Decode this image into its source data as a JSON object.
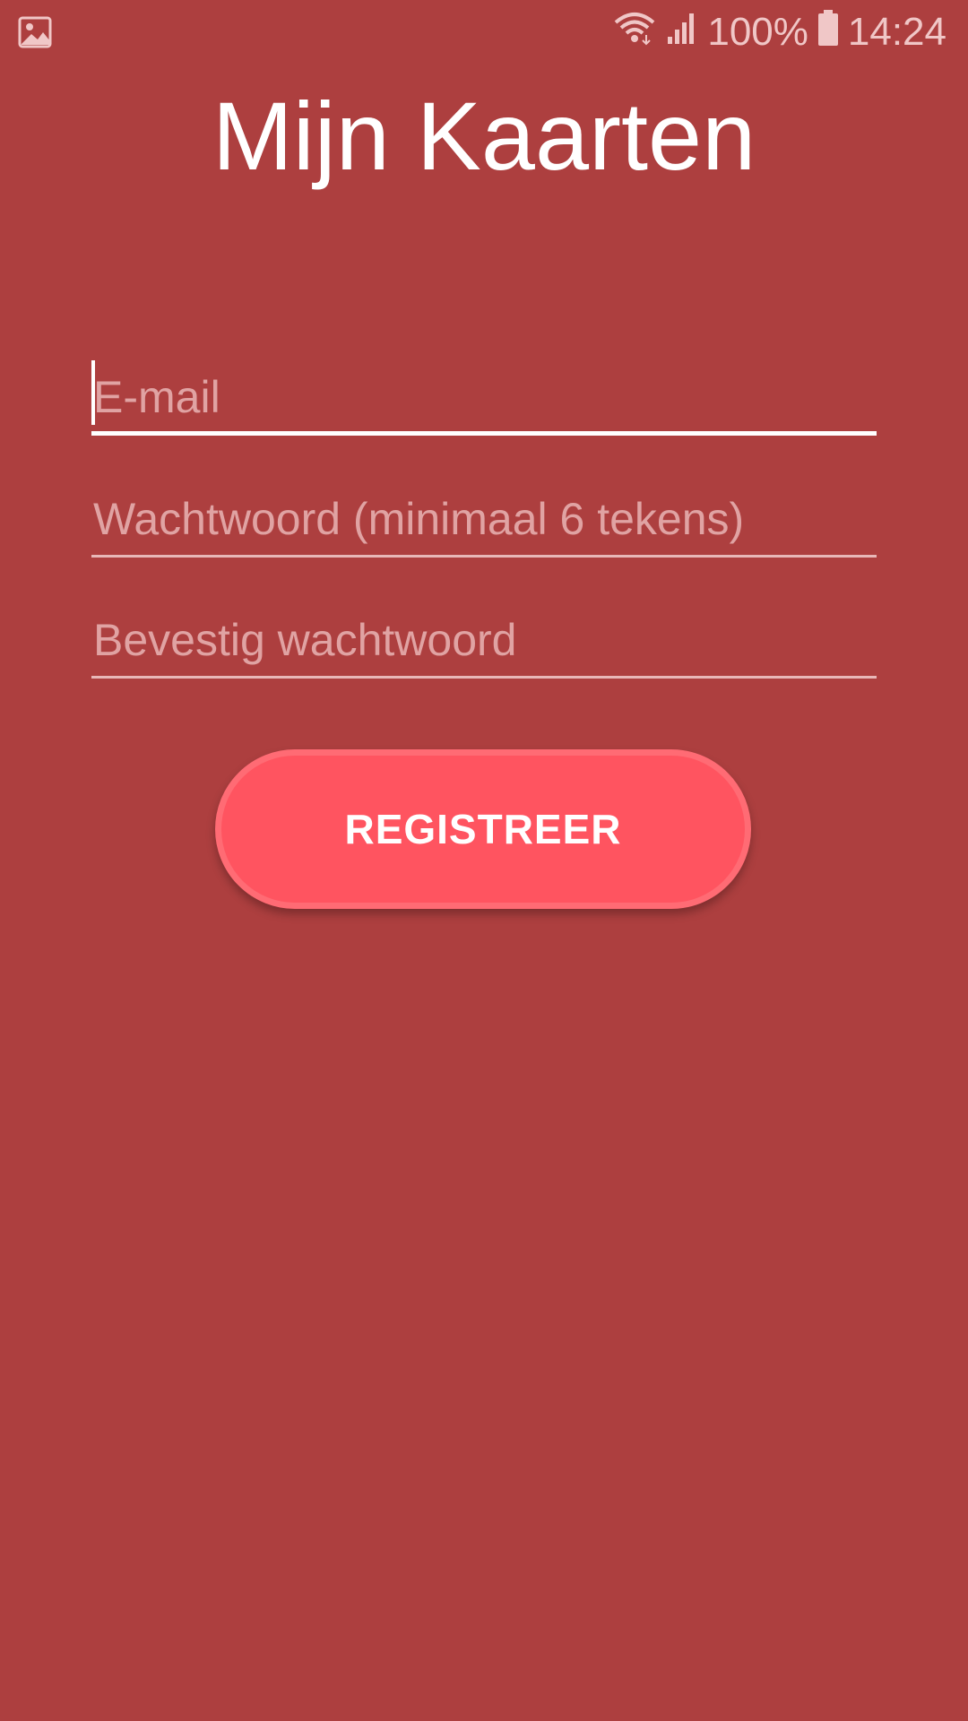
{
  "status_bar": {
    "battery_percent": "100%",
    "time": "14:24",
    "icons": [
      "image-icon",
      "wifi-icon",
      "signal-icon",
      "battery-icon"
    ]
  },
  "app": {
    "title": "Mijn Kaarten"
  },
  "form": {
    "email_placeholder": "E-mail",
    "password_placeholder": "Wachtwoord (minimaal 6 tekens)",
    "confirm_placeholder": "Bevestig wachtwoord",
    "register_label": "REGISTREER"
  },
  "colors": {
    "background": "#ad3f3f",
    "accent_button": "#ff5460",
    "text": "#ffffff",
    "placeholder": "#e0a3a3"
  }
}
